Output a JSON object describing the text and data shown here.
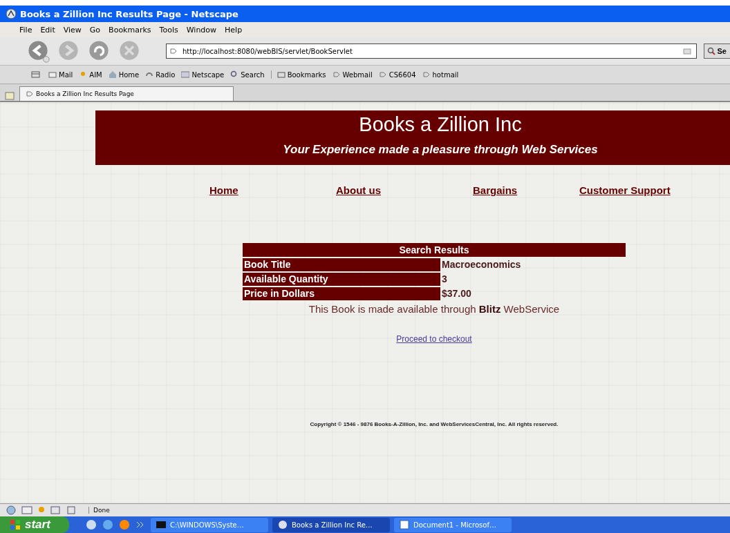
{
  "window": {
    "title": "Books a Zillion Inc Results Page - Netscape"
  },
  "menu_bar": [
    "File",
    "Edit",
    "View",
    "Go",
    "Bookmarks",
    "Tools",
    "Window",
    "Help"
  ],
  "nav_toolbar": {
    "url": "http://localhost:8080/webBIS/servlet/BookServlet",
    "search_button": "Se"
  },
  "personal_toolbar": [
    {
      "label": "Mail",
      "kind": "mail"
    },
    {
      "label": "AIM",
      "kind": "aim"
    },
    {
      "label": "Home",
      "kind": "home"
    },
    {
      "label": "Radio",
      "kind": "radio"
    },
    {
      "label": "Netscape",
      "kind": "my"
    },
    {
      "label": "Search",
      "kind": "search"
    },
    {
      "label": "Bookmarks",
      "kind": "folder"
    },
    {
      "label": "Webmail",
      "kind": "link"
    },
    {
      "label": "CS6604",
      "kind": "link"
    },
    {
      "label": "hotmail",
      "kind": "link"
    }
  ],
  "tabs": [
    {
      "label": "Books a Zillion Inc Results Page",
      "selected": true
    }
  ],
  "page": {
    "header": {
      "title": "Books a Zillion Inc",
      "subtitle": "Your Experience made a pleasure through Web Services"
    },
    "nav_links": [
      "Home",
      "About us",
      "Bargains",
      "Customer Support"
    ],
    "results": {
      "heading": "Search Results",
      "rows": [
        {
          "label": "Book Title",
          "value": "Macroeconomics"
        },
        {
          "label": "Available Quantity",
          "value": "3"
        },
        {
          "label": "Price in Dollars",
          "value": "$37.00"
        }
      ]
    },
    "note": "This Book is made available through **Blitz** WebService",
    "checkout_link": "Proceed to checkout",
    "copyright": "Copyright © 1546 - 9876 Books-A-Zillion, Inc. and WebServicesCentral, Inc. All rights reserved."
  },
  "status_bar": {
    "text": "Done"
  },
  "taskbar": {
    "start": "start",
    "tasks": [
      {
        "label": "C:\\WINDOWS\\Syste…",
        "selected": false,
        "kind": "console"
      },
      {
        "label": "Books a Zillion Inc Re…",
        "selected": true,
        "kind": "browser"
      },
      {
        "label": "Document1 - Microsof…",
        "selected": false,
        "kind": "word"
      }
    ]
  }
}
